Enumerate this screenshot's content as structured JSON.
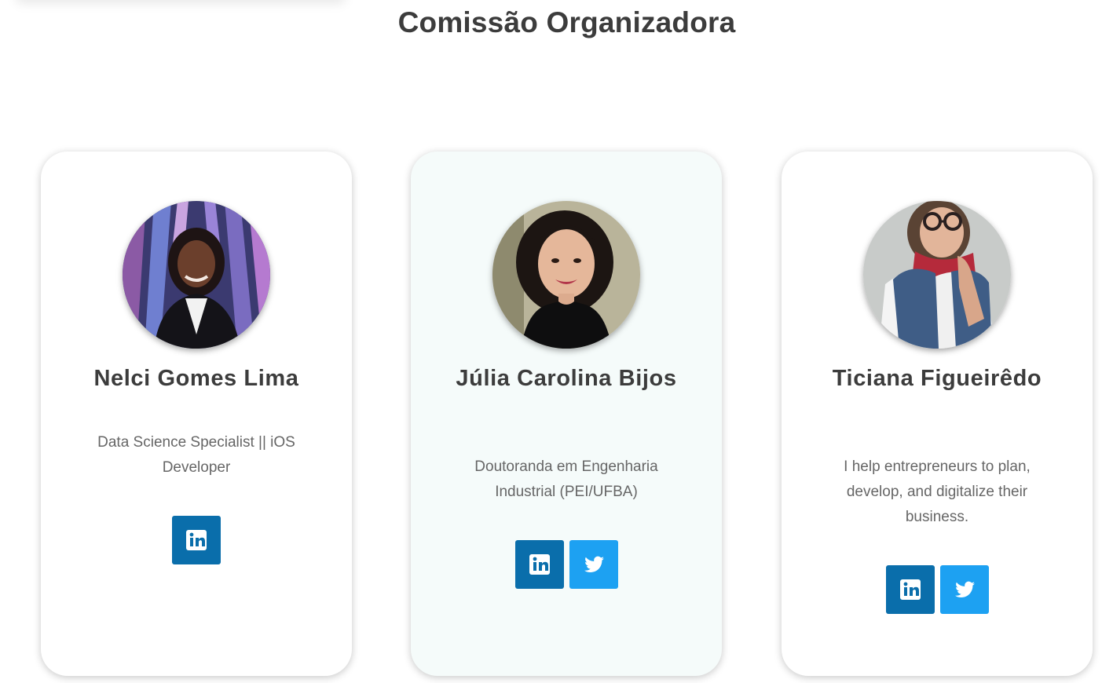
{
  "section": {
    "title": "Comissão Organizadora"
  },
  "colors": {
    "linkedin": "#0a6eab",
    "twitter": "#1da1f2",
    "title_text": "#3c3c3c",
    "bio_text": "#666666",
    "card_alt_background": "#f5fbfa"
  },
  "members": [
    {
      "name": "Nelci Gomes Lima",
      "bio": "Data Science Specialist || iOS Developer",
      "avatar": "portrait-photo",
      "socials": [
        "linkedin-icon"
      ]
    },
    {
      "name": "Júlia Carolina Bijos",
      "bio": "Doutoranda em Engenharia Industrial (PEI/UFBA)",
      "avatar": "portrait-photo",
      "socials": [
        "linkedin-icon",
        "twitter-icon"
      ]
    },
    {
      "name": "Ticiana Figueirêdo",
      "bio": "I help entrepreneurs to plan, develop, and digitalize their business.",
      "avatar": "portrait-photo",
      "socials": [
        "linkedin-icon",
        "twitter-icon"
      ]
    }
  ]
}
